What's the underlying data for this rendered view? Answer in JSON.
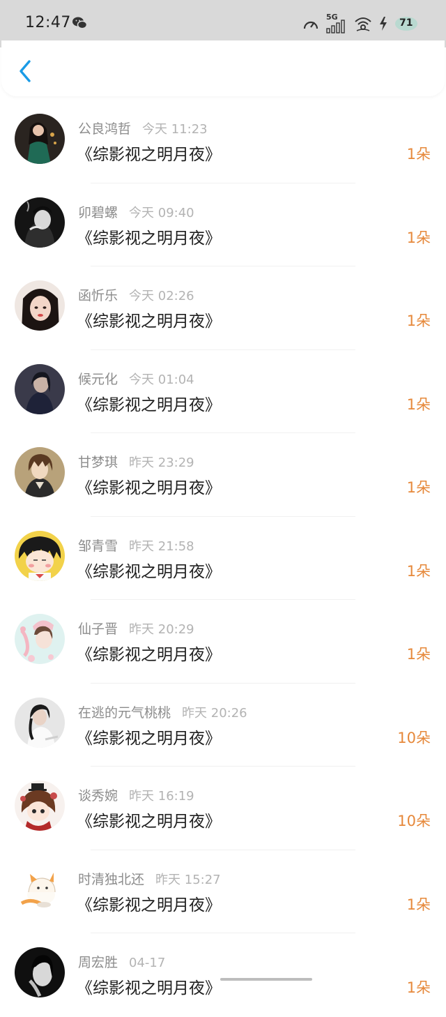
{
  "status_bar": {
    "time": "12:47",
    "network": "5G",
    "battery": "71",
    "icons": [
      "wechat-icon",
      "speed-meter-icon",
      "signal-icon",
      "wifi-icon",
      "charging-icon",
      "battery-icon"
    ]
  },
  "nav": {
    "back_icon": "chevron-left-icon",
    "accent_color": "#1a9be6"
  },
  "colors": {
    "flower_count": "#e6883a",
    "name": "#8c8c8c",
    "time": "#b3b3b3"
  },
  "records": [
    {
      "name": "公良鸿哲",
      "time": "今天 11:23",
      "title": "《综影视之明月夜》",
      "count": "1朵"
    },
    {
      "name": "卯碧螺",
      "time": "今天 09:40",
      "title": "《综影视之明月夜》",
      "count": "1朵"
    },
    {
      "name": "函忻乐",
      "time": "今天 02:26",
      "title": "《综影视之明月夜》",
      "count": "1朵"
    },
    {
      "name": "候元化",
      "time": "今天 01:04",
      "title": "《综影视之明月夜》",
      "count": "1朵"
    },
    {
      "name": "甘梦琪",
      "time": "昨天 23:29",
      "title": "《综影视之明月夜》",
      "count": "1朵"
    },
    {
      "name": "邹青雪",
      "time": "昨天 21:58",
      "title": "《综影视之明月夜》",
      "count": "1朵"
    },
    {
      "name": "仙子晋",
      "time": "昨天 20:29",
      "title": "《综影视之明月夜》",
      "count": "1朵"
    },
    {
      "name": "在逃的元气桃桃",
      "time": "昨天 20:26",
      "title": "《综影视之明月夜》",
      "count": "10朵"
    },
    {
      "name": "谈秀婉",
      "time": "昨天 16:19",
      "title": "《综影视之明月夜》",
      "count": "10朵"
    },
    {
      "name": "时清独北还",
      "time": "昨天 15:27",
      "title": "《综影视之明月夜》",
      "count": "1朵"
    },
    {
      "name": "周宏胜",
      "time": "04-17",
      "title": "《综影视之明月夜》",
      "count": "1朵"
    }
  ]
}
